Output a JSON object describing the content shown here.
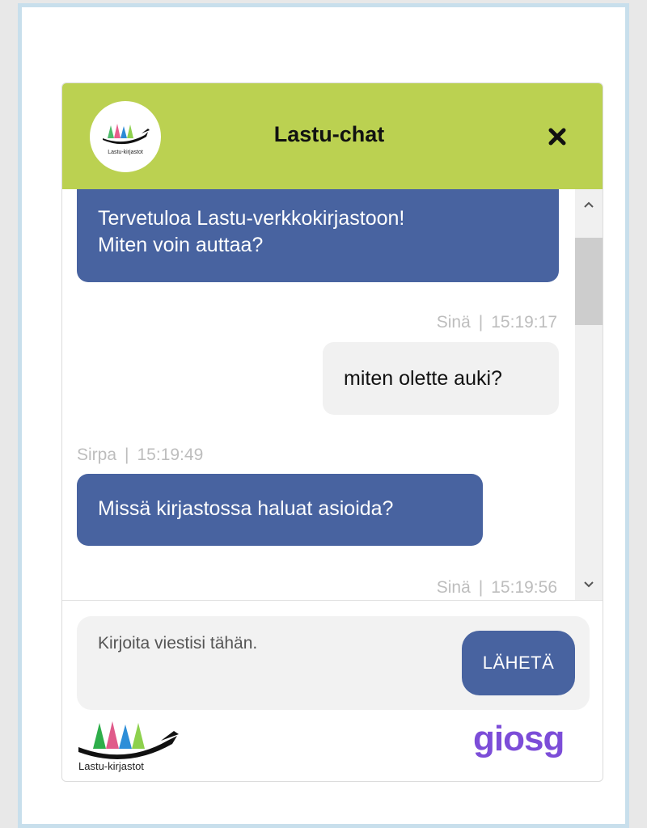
{
  "header": {
    "title": "Lastu-chat",
    "logo_text": "Lastu-kirjastot",
    "close_symbol": "✖"
  },
  "messages": [
    {
      "sender": "agent",
      "text_line1": "Tervetuloa Lastu-verkkokirjastoon!",
      "text_line2": "Miten voin auttaa?"
    },
    {
      "sender": "user",
      "author": "Sinä",
      "time": "15:19:17",
      "text": "miten olette auki?"
    },
    {
      "sender": "agent",
      "author": "Sirpa",
      "time": "15:19:49",
      "text": "Missä kirjastossa haluat asioida?"
    },
    {
      "sender": "user",
      "author": "Sinä",
      "time": "15:19:56"
    }
  ],
  "meta_separator": "|",
  "composer": {
    "placeholder": "Kirjoita viestisi tähän.",
    "send_label": "LÄHETÄ"
  },
  "footer": {
    "logo_text": "Lastu-kirjastot",
    "brand": "giosg"
  },
  "colors": {
    "header_bg": "#bbd151",
    "agent_bubble": "#4863a0",
    "user_bubble": "#f1f1f1",
    "brand_purple": "#7c4dd8",
    "brand_accent": "#f26b6b"
  },
  "icons": {
    "close": "close-icon",
    "scroll_up": "chevron-up-icon",
    "scroll_down": "chevron-down-icon"
  }
}
